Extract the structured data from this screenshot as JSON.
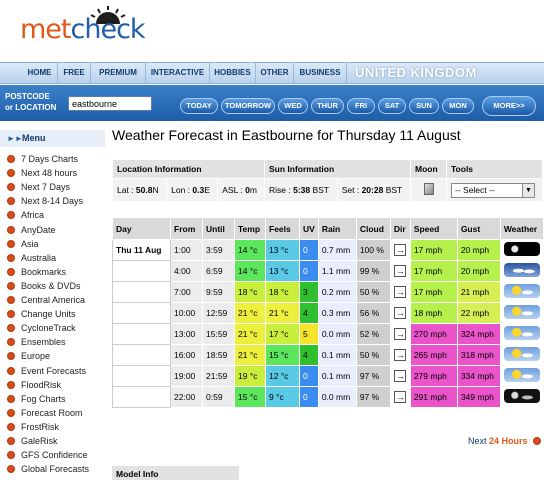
{
  "logo": {
    "part1": "met",
    "part2": "check"
  },
  "nav": {
    "tabs": [
      "HOME",
      "FREE",
      "PREMIUM",
      "INTERACTIVE",
      "HOBBIES",
      "OTHER",
      "BUSINESS"
    ],
    "country": "UNITED KINGDOM"
  },
  "location_bar": {
    "label_line1": "POSTCODE",
    "label_line2": "or LOCATION",
    "value": "eastbourne",
    "days": [
      "TODAY",
      "TOMORROW",
      "WED",
      "THUR",
      "FRI",
      "SAT",
      "SUN",
      "MON"
    ],
    "more": "MORE>>"
  },
  "sidebar": {
    "title": "Menu",
    "items": [
      "7 Days Charts",
      "Next 48 hours",
      "Next 7 Days",
      "Next 8-14 Days",
      "Africa",
      "AnyDate",
      "Asia",
      "Australia",
      "Bookmarks",
      "Books & DVDs",
      "Central America",
      "Change Units",
      "CycloneTrack",
      "Ensembles",
      "Europe",
      "Event Forecasts",
      "FloodRisk",
      "Fog Charts",
      "Forecast Room",
      "FrostRisk",
      "GaleRisk",
      "GFS Confidence",
      "Global Forecasts"
    ]
  },
  "page_title": "Weather Forecast in Eastbourne for Thursday 11 August",
  "info": {
    "headers": [
      "Location Information",
      "Sun Information",
      "Moon",
      "Tools"
    ],
    "lat_label": "Lat : ",
    "lat": "50.8",
    "lat_unit": "N",
    "lon_label": "Lon : ",
    "lon": "0.3",
    "lon_unit": "E",
    "asl_label": "ASL : ",
    "asl": "0",
    "asl_unit": "m",
    "rise_label": "Rise : ",
    "rise": "5:38",
    "rise_unit": " BST",
    "set_label": "Set : ",
    "set": "20:28",
    "set_unit": " BST",
    "tools_select": "-- Select --"
  },
  "forecast": {
    "headers": [
      "Day",
      "From",
      "Until",
      "Temp",
      "Feels",
      "UV",
      "Rain",
      "Cloud",
      "Dir",
      "Speed",
      "Gust",
      "Weather"
    ],
    "day_label": "Thu 11 Aug",
    "rows": [
      {
        "from": "1:00",
        "until": "3:59",
        "temp": "14 °c",
        "feels": "13 °c",
        "uv": "0",
        "rain": "0.7 mm",
        "cloud": "100 %",
        "speed": "17 mph",
        "gust": "20 mph",
        "temp_c": "#5ce65c",
        "feels_c": "#59c9e6",
        "uv_c": "#3b8cf0",
        "speed_c": "#b6f04d",
        "gust_c": "#b6f04d",
        "wx": "dark"
      },
      {
        "from": "4:00",
        "until": "6:59",
        "temp": "14 °c",
        "feels": "13 °c",
        "uv": "0",
        "rain": "1.1 mm",
        "cloud": "99 %",
        "speed": "17 mph",
        "gust": "20 mph",
        "temp_c": "#5ce65c",
        "feels_c": "#59c9e6",
        "uv_c": "#3b8cf0",
        "speed_c": "#b6f04d",
        "gust_c": "#b6f04d",
        "wx": "cloud"
      },
      {
        "from": "7:00",
        "until": "9:59",
        "temp": "18 °c",
        "feels": "18 °c",
        "uv": "3",
        "rain": "0.2 mm",
        "cloud": "50 %",
        "speed": "17 mph",
        "gust": "21 mph",
        "temp_c": "#c9ef3c",
        "feels_c": "#c9ef3c",
        "uv_c": "#2fbf2f",
        "speed_c": "#b6f04d",
        "gust_c": "#d8ee55",
        "wx": "sunny"
      },
      {
        "from": "10:00",
        "until": "12:59",
        "temp": "21 °c",
        "feels": "21 °c",
        "uv": "4",
        "rain": "0.3 mm",
        "cloud": "56 %",
        "speed": "18 mph",
        "gust": "22 mph",
        "temp_c": "#ecef3c",
        "feels_c": "#ecef3c",
        "uv_c": "#2fbf2f",
        "speed_c": "#b6f04d",
        "gust_c": "#d8ee55",
        "wx": "sunny"
      },
      {
        "from": "13:00",
        "until": "15:59",
        "temp": "21 °c",
        "feels": "17 °c",
        "uv": "5",
        "rain": "0.0 mm",
        "cloud": "52 %",
        "speed": "270 mph",
        "gust": "324 mph",
        "temp_c": "#ecef3c",
        "feels_c": "#c9ef3c",
        "uv_c": "#f5e52c",
        "speed_c": "#ea53c9",
        "gust_c": "#ea53c9",
        "wx": "sunny"
      },
      {
        "from": "16:00",
        "until": "18:59",
        "temp": "21 °c",
        "feels": "15 °c",
        "uv": "4",
        "rain": "0.1 mm",
        "cloud": "50 %",
        "speed": "265 mph",
        "gust": "318 mph",
        "temp_c": "#ecef3c",
        "feels_c": "#5ce65c",
        "uv_c": "#2fbf2f",
        "speed_c": "#ea53c9",
        "gust_c": "#ea53c9",
        "wx": "sunny"
      },
      {
        "from": "19:00",
        "until": "21:59",
        "temp": "19 °c",
        "feels": "12 °c",
        "uv": "0",
        "rain": "0.1 mm",
        "cloud": "97 %",
        "speed": "279 mph",
        "gust": "334 mph",
        "temp_c": "#c9ef3c",
        "feels_c": "#59c9e6",
        "uv_c": "#3b8cf0",
        "speed_c": "#ea53c9",
        "gust_c": "#ea53c9",
        "wx": "sunny"
      },
      {
        "from": "22:00",
        "until": "0:59",
        "temp": "15 °c",
        "feels": "9 °c",
        "uv": "0",
        "rain": "0.0 mm",
        "cloud": "97 %",
        "speed": "291 mph",
        "gust": "349 mph",
        "temp_c": "#5ce65c",
        "feels_c": "#59c9e6",
        "uv_c": "#3b8cf0",
        "speed_c": "#ea53c9",
        "gust_c": "#ea53c9",
        "wx": "night"
      }
    ]
  },
  "next": {
    "prefix": "Next ",
    "hours": "24 Hours"
  },
  "model_info": "Model Info",
  "colors": {
    "brand_orange": "#e05a1a",
    "brand_blue": "#1e5fa8",
    "day_bar": "#1e5da8"
  }
}
